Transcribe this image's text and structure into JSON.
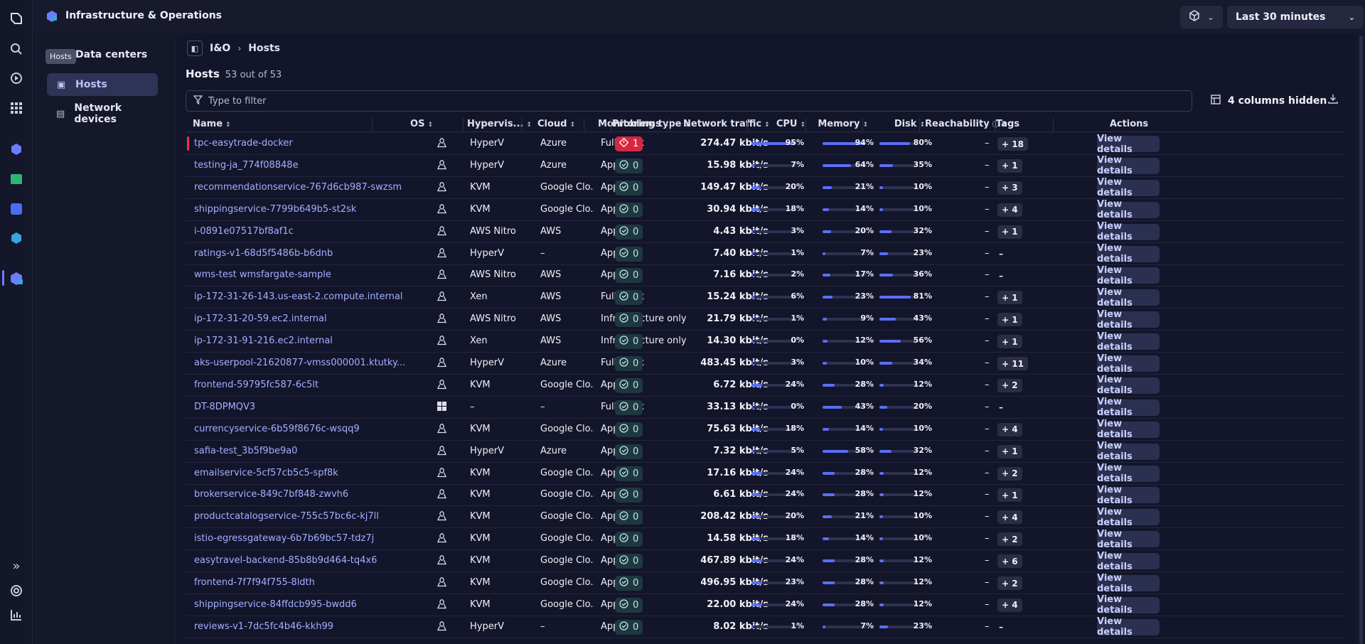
{
  "app": {
    "title": "Infrastructure & Operations"
  },
  "topbar": {
    "timeframe": "Last 30 minutes"
  },
  "tooltip": "Hosts",
  "sidenav": [
    {
      "label": "Data centers",
      "icon": "building-icon"
    },
    {
      "label": "Hosts",
      "icon": "host-icon",
      "active": true
    },
    {
      "label": "Network devices",
      "icon": "network-device-icon"
    }
  ],
  "breadcrumb": {
    "root": "I&O",
    "current": "Hosts"
  },
  "hosts": {
    "heading": "Hosts",
    "count": "53 out of 53"
  },
  "filter": {
    "placeholder": "Type to filter"
  },
  "columns_hidden": "4 columns hidden",
  "columns": [
    "Name",
    "OS",
    "Hypervis...",
    "Cloud",
    "Monitoring type",
    "Problems",
    "Network traffic",
    "CPU",
    "Memory",
    "Disk",
    "Reachability",
    "Tags",
    "Actions"
  ],
  "view_label": "View details",
  "rows": [
    {
      "name": "tpc-easytrade-docker",
      "os": "linux",
      "hyp": "HyperV",
      "cloud": "Azure",
      "mon": "Full stack",
      "prob": "1",
      "err": true,
      "net": "274.47 kbit/s",
      "cpu": 95,
      "mem": 94,
      "disk": 80,
      "reach": "–",
      "tags": "+ 18"
    },
    {
      "name": "testing-ja_774f08848e",
      "os": "linux",
      "hyp": "HyperV",
      "cloud": "Azure",
      "mon": "App only",
      "prob": "0",
      "net": "15.98 kbit/s",
      "cpu": 7,
      "mem": 64,
      "disk": 35,
      "reach": "–",
      "tags": "+ 1"
    },
    {
      "name": "recommendationservice-767d6cb987-swzsm",
      "os": "linux",
      "hyp": "KVM",
      "cloud": "Google Clo...",
      "mon": "App only",
      "prob": "0",
      "net": "149.47 kbit/s",
      "cpu": 20,
      "mem": 21,
      "disk": 10,
      "reach": "–",
      "tags": "+ 3"
    },
    {
      "name": "shippingservice-7799b649b5-st2sk",
      "os": "linux",
      "hyp": "KVM",
      "cloud": "Google Clo...",
      "mon": "App only",
      "prob": "0",
      "net": "30.94 kbit/s",
      "cpu": 18,
      "mem": 14,
      "disk": 10,
      "reach": "–",
      "tags": "+ 4"
    },
    {
      "name": "i-0891e07517bf8af1c",
      "os": "linux",
      "hyp": "AWS Nitro",
      "cloud": "AWS",
      "mon": "App only",
      "prob": "0",
      "net": "4.43 kbit/s",
      "cpu": 3,
      "mem": 20,
      "disk": 32,
      "reach": "–",
      "tags": "+ 1"
    },
    {
      "name": "ratings-v1-68d5f5486b-b6dnb",
      "os": "linux",
      "hyp": "HyperV",
      "cloud": "–",
      "mon": "App only",
      "prob": "0",
      "net": "7.40 kbit/s",
      "cpu": 1,
      "mem": 7,
      "disk": 23,
      "reach": "–",
      "tags": "–"
    },
    {
      "name": "wms-test wmsfargate-sample",
      "os": "linux",
      "hyp": "AWS Nitro",
      "cloud": "AWS",
      "mon": "App only",
      "prob": "0",
      "net": "7.16 kbit/s",
      "cpu": 2,
      "mem": 17,
      "disk": 36,
      "reach": "–",
      "tags": "–"
    },
    {
      "name": "ip-172-31-26-143.us-east-2.compute.internal",
      "os": "linux",
      "hyp": "Xen",
      "cloud": "AWS",
      "mon": "Full stack",
      "prob": "0",
      "net": "15.24 kbit/s",
      "cpu": 6,
      "mem": 23,
      "disk": 81,
      "reach": "–",
      "tags": "+ 1"
    },
    {
      "name": "ip-172-31-20-59.ec2.internal",
      "os": "linux",
      "hyp": "AWS Nitro",
      "cloud": "AWS",
      "mon": "Infrastructure only",
      "prob": "0",
      "net": "21.79 kbit/s",
      "cpu": 1,
      "mem": 9,
      "disk": 43,
      "reach": "–",
      "tags": "+ 1"
    },
    {
      "name": "ip-172-31-91-216.ec2.internal",
      "os": "linux",
      "hyp": "Xen",
      "cloud": "AWS",
      "mon": "Infrastructure only",
      "prob": "0",
      "net": "14.30 kbit/s",
      "cpu": 0,
      "mem": 12,
      "disk": 56,
      "reach": "–",
      "tags": "+ 1"
    },
    {
      "name": "aks-userpool-21620877-vmss000001.ktutky...",
      "os": "linux",
      "hyp": "HyperV",
      "cloud": "Azure",
      "mon": "Full stack",
      "prob": "0",
      "net": "483.45 kbit/s",
      "cpu": 3,
      "mem": 10,
      "disk": 34,
      "reach": "–",
      "tags": "+ 11"
    },
    {
      "name": "frontend-59795fc587-6c5lt",
      "os": "linux",
      "hyp": "KVM",
      "cloud": "Google Clo...",
      "mon": "App only",
      "prob": "0",
      "net": "6.72 kbit/s",
      "cpu": 24,
      "mem": 28,
      "disk": 12,
      "reach": "–",
      "tags": "+ 2"
    },
    {
      "name": "DT-8DPMQV3",
      "os": "windows",
      "hyp": "–",
      "cloud": "–",
      "mon": "Full stack",
      "prob": "0",
      "net": "33.13 kbit/s",
      "cpu": 0,
      "mem": 43,
      "disk": 20,
      "reach": "–",
      "tags": "–"
    },
    {
      "name": "currencyservice-6b59f8676c-wsqq9",
      "os": "linux",
      "hyp": "KVM",
      "cloud": "Google Clo...",
      "mon": "App only",
      "prob": "0",
      "net": "75.63 kbit/s",
      "cpu": 18,
      "mem": 14,
      "disk": 10,
      "reach": "–",
      "tags": "+ 4"
    },
    {
      "name": "safia-test_3b5f9be9a0",
      "os": "linux",
      "hyp": "HyperV",
      "cloud": "Azure",
      "mon": "App only",
      "prob": "0",
      "net": "7.32 kbit/s",
      "cpu": 5,
      "mem": 58,
      "disk": 32,
      "reach": "–",
      "tags": "+ 1"
    },
    {
      "name": "emailservice-5cf57cb5c5-spf8k",
      "os": "linux",
      "hyp": "KVM",
      "cloud": "Google Clo...",
      "mon": "App only",
      "prob": "0",
      "net": "17.16 kbit/s",
      "cpu": 24,
      "mem": 28,
      "disk": 12,
      "reach": "–",
      "tags": "+ 2"
    },
    {
      "name": "brokerservice-849c7bf848-zwvh6",
      "os": "linux",
      "hyp": "KVM",
      "cloud": "Google Clo...",
      "mon": "App only",
      "prob": "0",
      "net": "6.61 kbit/s",
      "cpu": 24,
      "mem": 28,
      "disk": 12,
      "reach": "–",
      "tags": "+ 1"
    },
    {
      "name": "productcatalogservice-755c57bc6c-kj7ll",
      "os": "linux",
      "hyp": "KVM",
      "cloud": "Google Clo...",
      "mon": "App only",
      "prob": "0",
      "net": "208.42 kbit/s",
      "cpu": 20,
      "mem": 21,
      "disk": 10,
      "reach": "–",
      "tags": "+ 4"
    },
    {
      "name": "istio-egressgateway-6b7b69bc57-tdz7j",
      "os": "linux",
      "hyp": "KVM",
      "cloud": "Google Clo...",
      "mon": "App only",
      "prob": "0",
      "net": "14.58 kbit/s",
      "cpu": 18,
      "mem": 14,
      "disk": 10,
      "reach": "–",
      "tags": "+ 2"
    },
    {
      "name": "easytravel-backend-85b8b9d464-tq4x6",
      "os": "linux",
      "hyp": "KVM",
      "cloud": "Google Clo...",
      "mon": "App only",
      "prob": "0",
      "net": "467.89 kbit/s",
      "cpu": 24,
      "mem": 28,
      "disk": 12,
      "reach": "–",
      "tags": "+ 6"
    },
    {
      "name": "frontend-7f7f94f755-8ldth",
      "os": "linux",
      "hyp": "KVM",
      "cloud": "Google Clo...",
      "mon": "App only",
      "prob": "0",
      "net": "496.95 kbit/s",
      "cpu": 23,
      "mem": 28,
      "disk": 12,
      "reach": "–",
      "tags": "+ 2"
    },
    {
      "name": "shippingservice-84ffdcb995-bwdd6",
      "os": "linux",
      "hyp": "KVM",
      "cloud": "Google Clo...",
      "mon": "App only",
      "prob": "0",
      "net": "22.00 kbit/s",
      "cpu": 24,
      "mem": 28,
      "disk": 12,
      "reach": "–",
      "tags": "+ 4"
    },
    {
      "name": "reviews-v1-7dc5fc4b46-kkh99",
      "os": "linux",
      "hyp": "HyperV",
      "cloud": "–",
      "mon": "App only",
      "prob": "0",
      "net": "8.02 kbit/s",
      "cpu": 1,
      "mem": 7,
      "disk": 23,
      "reach": "–",
      "tags": "–"
    }
  ]
}
